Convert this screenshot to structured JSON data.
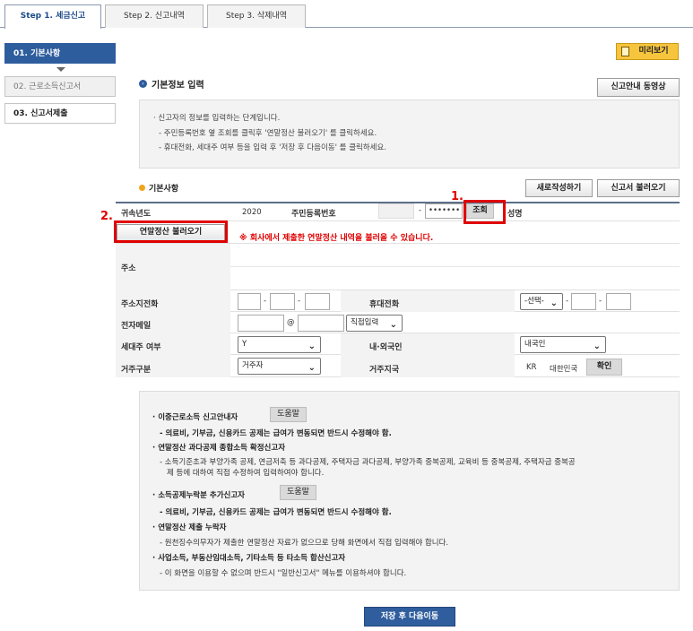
{
  "tabs": [
    {
      "label": "Step 1. 세금신고",
      "active": true
    },
    {
      "label": "Step 2. 신고내역",
      "active": false
    },
    {
      "label": "Step 3. 삭제내역",
      "active": false
    }
  ],
  "sidebar": {
    "items": [
      {
        "label": "01. 기본사항",
        "state": "active"
      },
      {
        "label": "02. 근로소득신고서",
        "state": "inactive"
      },
      {
        "label": "03. 신고서제출",
        "state": "normal"
      }
    ]
  },
  "header": {
    "preview_label": "미리보기",
    "section_title": "기본정보 입력",
    "guide_video_label": "신고안내 동영상"
  },
  "info": {
    "lines": [
      "· 신고자의 정보를 입력하는 단계입니다.",
      "- 주민등록번호 옆 조회를 클릭후 '연말정산 불러오기' 를 클릭하세요.",
      "- 휴대전화, 세대주 여부 등을 입력 후 '저장 후 다음이동' 를 클릭하세요."
    ]
  },
  "basic": {
    "title": "기본사항",
    "new_write_label": "새로작성하기",
    "load_return_label": "신고서 불러오기",
    "year_label": "귀속년도",
    "year_value": "2020",
    "rrn_label": "주민등록번호",
    "rrn_dash": "-",
    "rrn_masked": "•••••••",
    "lookup_label": "조회",
    "name_label": "성명",
    "year_end_load_label": "연말정산 불러오기",
    "year_end_warning": "※ 회사에서 제출한 연말정산 내역을 불러올 수 있습니다.",
    "address_label": "주소",
    "home_phone_label": "주소지전화",
    "mobile_label": "휴대전화",
    "mobile_select": "-선택-",
    "email_label": "전자메일",
    "email_at": "@",
    "email_domain_select": "직접입력",
    "householder_label": "세대주 여부",
    "householder_value": "Y",
    "nationality_label": "내·외국인",
    "nationality_value": "내국인",
    "residence_label": "거주구분",
    "residence_value": "거주자",
    "residence_country_label": "거주지국",
    "residence_country_code": "KR",
    "residence_country_name": "대한민국",
    "confirm_label": "확인"
  },
  "annotations": {
    "step1": "1.",
    "step2": "2."
  },
  "notes": {
    "n1_title": "· 이중근로소득 신고안내자",
    "n1_help": "도움말",
    "n1_text": "- 의료비, 기부금, 신용카드 공제는 급여가 변동되면 반드시 수정해야 함.",
    "n2_title": "· 연말정산 과다공제 종합소득 확정신고자",
    "n2_text1": "- 소득기준초과 부양가족 공제, 연금저축 등 과다공제, 주택자금 과다공제, 부양가족 중복공제, 교육비 등 중복공제, 주택자금 중복공",
    "n2_text2": "제 등에 대하여 직접 수정하여 입력하여야 합니다.",
    "n3_title": "· 소득공제누락분 추가신고자",
    "n3_help": "도움말",
    "n3_text": "- 의료비, 기부금, 신용카드 공제는 급여가 변동되면 반드시 수정해야 함.",
    "n4_title": "· 연말정산 제출 누락자",
    "n4_text": "- 원천징수의무자가 제출한 연말정산 자료가 없으므로 당해 화면에서 직접 입력해야 합니다.",
    "n5_title": "· 사업소득, 부동산임대소득, 기타소득 등 타소득 합산신고자",
    "n5_text": "- 이 화면을 이용할 수 없으며 반드시 \"일반신고서\" 메뉴를 이용하셔야 합니다."
  },
  "footer": {
    "save_next_label": "저장 후 다음이동"
  }
}
